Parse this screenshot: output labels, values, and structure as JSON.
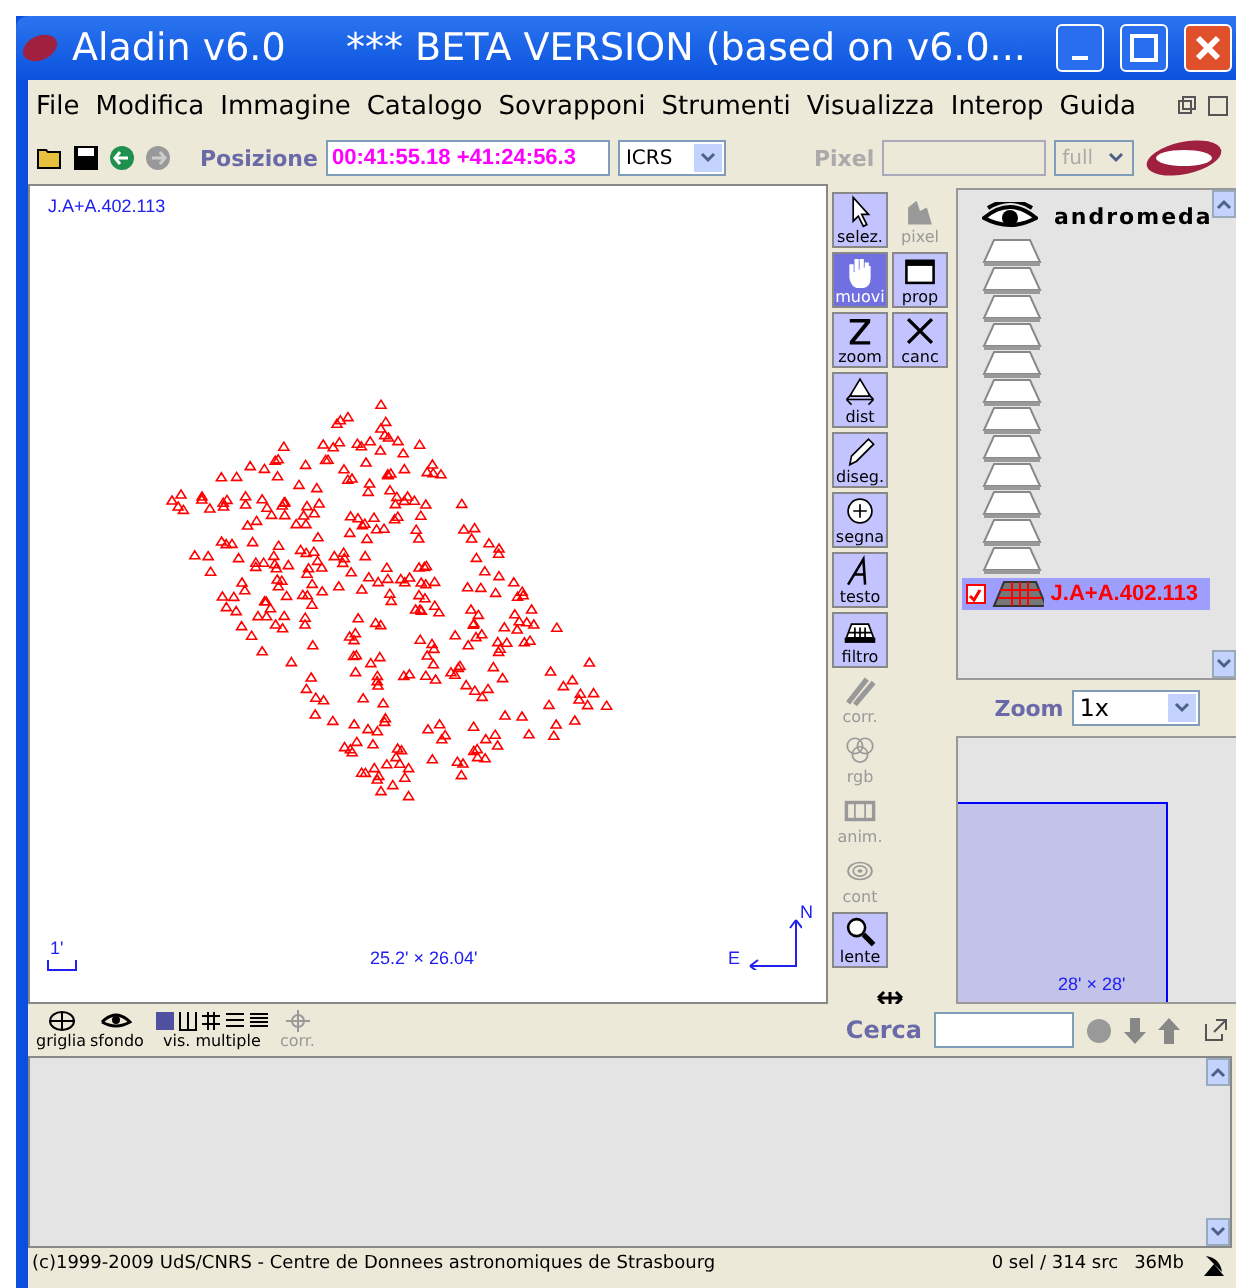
{
  "window": {
    "title": "Aladin v6.0     *** BETA VERSION (based on v6.0..."
  },
  "menu": [
    "File",
    "Modifica",
    "Immagine",
    "Catalogo",
    "Sovrapponi",
    "Strumenti",
    "Visualizza",
    "Interop",
    "Guida"
  ],
  "toolbar": {
    "position_label": "Posizione",
    "position_value": "00:41:55.18 +41:24:56.3",
    "frame": "ICRS",
    "pixel_label": "Pixel",
    "pixel_mode": "full",
    "pixel_disabled": true
  },
  "view": {
    "plane_label": "J.A+A.402.113",
    "scale": "1'",
    "size": "25.2' × 26.04'",
    "north": "N",
    "east": "E"
  },
  "tools": [
    {
      "label": "selez.",
      "selected": false,
      "disabled": false
    },
    {
      "label": "pixel",
      "selected": false,
      "disabled": true
    },
    {
      "label": "muovi",
      "selected": true,
      "disabled": false
    },
    {
      "label": "prop",
      "selected": false,
      "disabled": false
    },
    {
      "label": "zoom",
      "selected": false,
      "disabled": false
    },
    {
      "label": "canc",
      "selected": false,
      "disabled": false
    },
    {
      "label": "dist",
      "selected": false,
      "disabled": false
    },
    {
      "label": "diseg.",
      "selected": false,
      "disabled": false
    },
    {
      "label": "segna",
      "selected": false,
      "disabled": false
    },
    {
      "label": "testo",
      "selected": false,
      "disabled": false
    },
    {
      "label": "filtro",
      "selected": false,
      "disabled": false
    },
    {
      "label": "corr.",
      "selected": false,
      "disabled": true
    },
    {
      "label": "rgb",
      "selected": false,
      "disabled": true
    },
    {
      "label": "anim.",
      "selected": false,
      "disabled": true
    },
    {
      "label": "cont",
      "selected": false,
      "disabled": true
    },
    {
      "label": "lente",
      "selected": false,
      "disabled": false
    }
  ],
  "layers": {
    "title": "andromeda",
    "planes": [
      {
        "name": "J.A+A.402.113",
        "checked": true,
        "selected": true
      }
    ]
  },
  "zoom": {
    "label": "Zoom",
    "value": "1x"
  },
  "overview": {
    "size": "28' × 28'"
  },
  "bottom_tools": {
    "grid": "griglia",
    "background": "sfondo",
    "multiview": "vis. multiple",
    "corr": "corr."
  },
  "search": {
    "label": "Cerca"
  },
  "status": {
    "copyright": "(c)1999-2009 UdS/CNRS - Centre de Donnees astronomiques de Strasbourg",
    "selection": "0 sel / 314 src",
    "memory": "36Mb"
  }
}
